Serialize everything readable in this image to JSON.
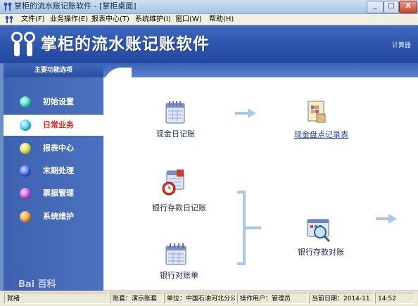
{
  "window": {
    "title": "掌柜的流水账记账软件 - [掌柜桌面]",
    "min_label": "_",
    "max_label": "□",
    "close_label": "X"
  },
  "menu": [
    {
      "label": "文件(F)"
    },
    {
      "label": "业务操作(E)"
    },
    {
      "label": "报表中心(T)"
    },
    {
      "label": "系统维护(I)"
    },
    {
      "label": "窗口(W)"
    },
    {
      "label": "帮助(H)"
    }
  ],
  "banner": {
    "title": "掌柜的流水账记账软件",
    "calculator_link": "计算器"
  },
  "sidebar": {
    "header": "主要功能选项",
    "items": [
      {
        "label": "初始设置",
        "color": "#3fd6c6",
        "active": false
      },
      {
        "label": "日常业务",
        "color": "#36d2e6",
        "active": true
      },
      {
        "label": "报表中心",
        "color": "#d9e04a",
        "active": false
      },
      {
        "label": "末期处理",
        "color": "#3a5fe0",
        "active": false
      },
      {
        "label": "票据管理",
        "color": "#c64fcf",
        "active": false
      },
      {
        "label": "系统维护",
        "color": "#f0a03a",
        "active": false
      }
    ]
  },
  "modules": {
    "cash_journal": "现金日记账",
    "cash_count": "现金盘点记录表",
    "bank_journal": "银行存款日记账",
    "bank_reconcile": "银行存款对账",
    "bank_statement": "银行对账单"
  },
  "status": {
    "ready": "就绪",
    "book": "账套：演示账套",
    "unit": "单位：中国石油河北分公",
    "user": "操作用户：管理员",
    "date": "当前日期：2014-11",
    "time": "14:52"
  },
  "watermark": "Bai 百科",
  "colors": {
    "banner_blue": "#2d56ac",
    "active_text": "#e2231a",
    "link_blue": "#1f3cbb"
  }
}
